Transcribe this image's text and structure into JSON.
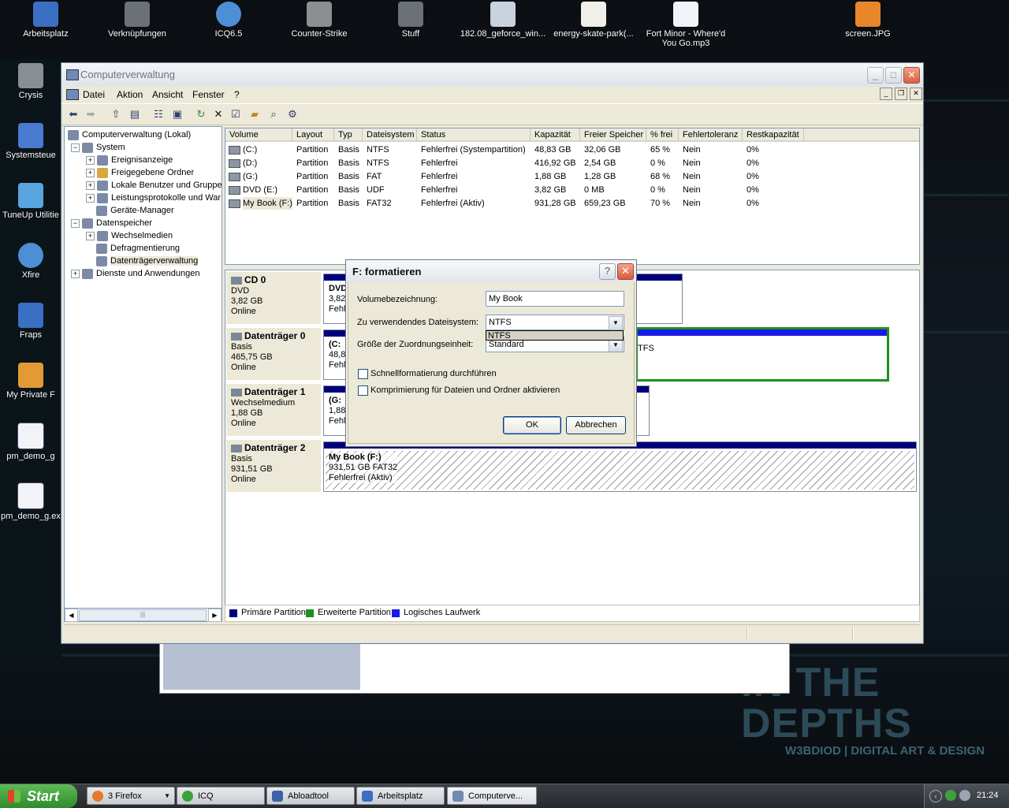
{
  "desktop": {
    "top_icons": [
      "Arbeitsplatz",
      "Verknüpfungen",
      "ICQ6.5",
      "Counter-Strike",
      "Stuff",
      "182.08_geforce_win...",
      "energy-skate-park(...",
      "Fort Minor - Where'd You Go.mp3",
      "screen.JPG"
    ],
    "left_icons": [
      "Crysis",
      "Systemsteue",
      "TuneUp Utilitie",
      "Xfire",
      "Fraps",
      "My Private F",
      "pm_demo_g",
      "pm_demo_g.ex"
    ],
    "wallpaper_text": {
      "big": "IN THE DEPTHS",
      "small": "W3BDIOD | DIGITAL ART & DESIGN"
    }
  },
  "window": {
    "title": "Computerverwaltung",
    "menu": [
      "Datei",
      "Aktion",
      "Ansicht",
      "Fenster",
      "?"
    ]
  },
  "tree": {
    "items": [
      "Computerverwaltung (Lokal)",
      "System",
      "Ereignisanzeige",
      "Freigegebene Ordner",
      "Lokale Benutzer und Gruppe",
      "Leistungsprotokolle und War",
      "Geräte-Manager",
      "Datenspeicher",
      "Wechselmedien",
      "Defragmentierung",
      "Datenträgerverwaltung",
      "Dienste und Anwendungen"
    ]
  },
  "volumes": {
    "headers": [
      "Volume",
      "Layout",
      "Typ",
      "Dateisystem",
      "Status",
      "Kapazität",
      "Freier Speicher",
      "% frei",
      "Fehlertoleranz",
      "Restkapazität"
    ],
    "rows": [
      [
        "(C:)",
        "Partition",
        "Basis",
        "NTFS",
        "Fehlerfrei (Systempartition)",
        "48,83 GB",
        "32,06 GB",
        "65 %",
        "Nein",
        "0%"
      ],
      [
        "(D:)",
        "Partition",
        "Basis",
        "NTFS",
        "Fehlerfrei",
        "416,92 GB",
        "2,54 GB",
        "0 %",
        "Nein",
        "0%"
      ],
      [
        "(G:)",
        "Partition",
        "Basis",
        "FAT",
        "Fehlerfrei",
        "1,88 GB",
        "1,28 GB",
        "68 %",
        "Nein",
        "0%"
      ],
      [
        "DVD (E:)",
        "Partition",
        "Basis",
        "UDF",
        "Fehlerfrei",
        "3,82 GB",
        "0 MB",
        "0 %",
        "Nein",
        "0%"
      ],
      [
        "My Book (F:)",
        "Partition",
        "Basis",
        "FAT32",
        "Fehlerfrei (Aktiv)",
        "931,28 GB",
        "659,23 GB",
        "70 %",
        "Nein",
        "0%"
      ]
    ]
  },
  "disks": [
    {
      "name": "CD 0",
      "type": "DVD",
      "size": "3,82 GB",
      "state": "Online",
      "part": [
        "DVD",
        "3,82",
        "Fehle"
      ]
    },
    {
      "name": "Datenträger 0",
      "type": "Basis",
      "size": "465,75 GB",
      "state": "Online",
      "part": [
        "(C:",
        "48,8",
        "Fehle"
      ],
      "ext": "TFS"
    },
    {
      "name": "Datenträger 1",
      "type": "Wechselmedium",
      "size": "1,88 GB",
      "state": "Online",
      "part": [
        "(G:",
        "1,88",
        "Fehle"
      ]
    },
    {
      "name": "Datenträger 2",
      "type": "Basis",
      "size": "931,51 GB",
      "state": "Online",
      "part": [
        "My Book  (F:)",
        "931,51 GB FAT32",
        "Fehlerfrei (Aktiv)"
      ]
    }
  ],
  "legend": [
    "Primäre Partition",
    "Erweiterte Partition",
    "Logisches Laufwerk"
  ],
  "colors": {
    "primary": "#00007b",
    "extended": "#1f8f1f",
    "logical": "#1a1ae6"
  },
  "dialog": {
    "title": "F: formatieren",
    "label_volume": "Volumebezeichnung:",
    "volume_value": "My Book",
    "label_fs": "Zu verwendendes Dateisystem:",
    "fs_value": "NTFS",
    "fs_option": "NTFS",
    "label_alloc": "Größe der Zuordnungseinheit:",
    "alloc_value": "Standard",
    "quick_format": "Schnellformatierung durchführen",
    "compression": "Komprimierung für Dateien und Ordner aktivieren",
    "ok": "OK",
    "cancel": "Abbrechen"
  },
  "taskbar": {
    "start": "Start",
    "tasks": [
      {
        "label": "3 Firefox",
        "icon": "firefox-icon"
      },
      {
        "label": "ICQ",
        "icon": "icq-icon"
      },
      {
        "label": "Abloadtool",
        "icon": "abloadtool-icon"
      },
      {
        "label": "Arbeitsplatz",
        "icon": "computer-icon"
      },
      {
        "label": "Computerve...",
        "icon": "computer-management-icon"
      }
    ],
    "clock": "21:24"
  }
}
